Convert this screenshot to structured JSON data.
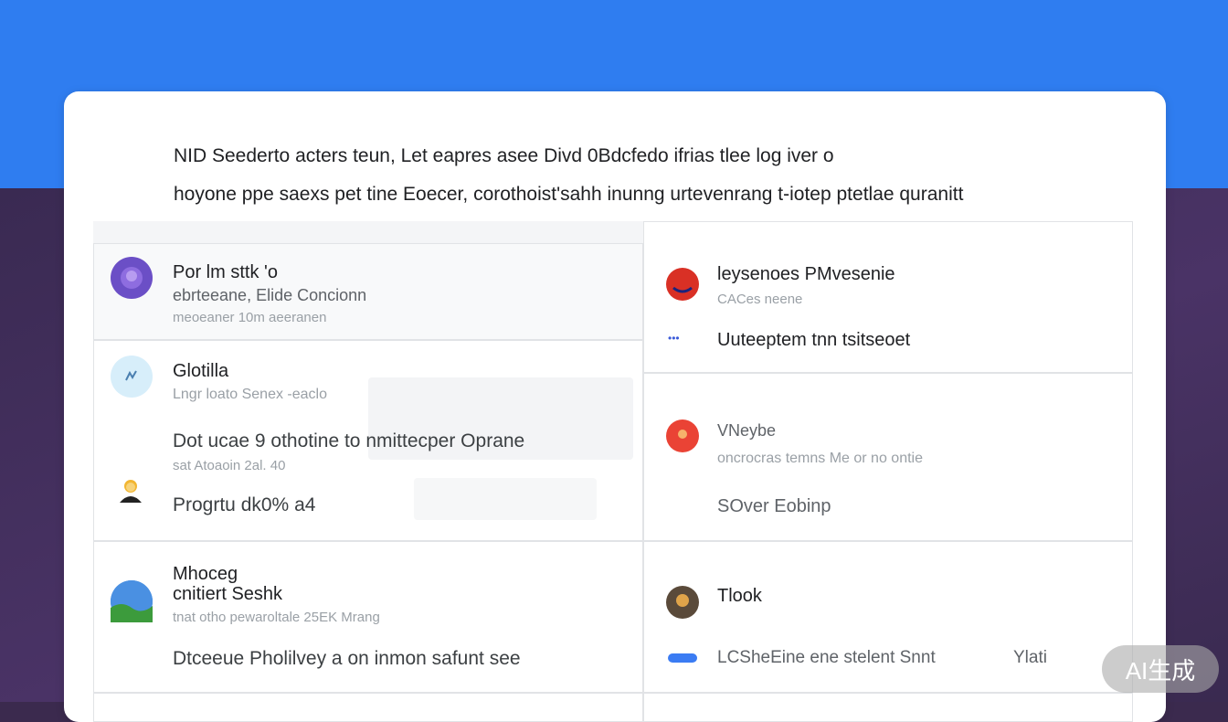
{
  "header": {
    "line1": "NID Seederto acters teun, Let eapres asee Divd 0Bdcfedo ifrias tlee log iver o",
    "line2": "hoyone ppe saexs pet tine Eoecer, corothoist'sahh inunng urtevenrang t-iotep ptetlae quranitt"
  },
  "cards": [
    {
      "id": "a",
      "title": "Por lm sttk 'o",
      "subtitle": "ebrteeane, Elide Concionn",
      "meta": "meoeaner 10m aeeranen",
      "avatar_icon": "profile-icon",
      "avatar_color": "#6b4fc6"
    },
    {
      "id": "b",
      "title": "leysenoes PMvesenie",
      "subtitle": "CACes neene",
      "body": "Uuteeptem tnn tsitseoet",
      "avatar_icon": "profile-icon",
      "avatar_color": "#d93025",
      "small_icon": "link-icon"
    },
    {
      "id": "c",
      "title": "Glotilla",
      "subtitle": "Lngr loato Senex -eaclo",
      "body": "Dot ucae 9 othotine to nmittecper Oprane",
      "meta": "sat Atoaoin 2al. 40",
      "footer": "Progrtu dk0% a4",
      "avatar_icon": "chat-icon",
      "avatar_color": "#d7eefa",
      "small_avatar_icon": "user-icon"
    },
    {
      "id": "d",
      "title": "VNeybe",
      "subtitle": "oncrocras temns Me or no ontie",
      "body": "SOver Eobinp",
      "avatar_icon": "profile-icon",
      "avatar_color": "#ea4335"
    },
    {
      "id": "e",
      "title": "Mhoceg",
      "title2": "cnitiert Seshk",
      "subtitle": "tnat otho pewaroltale 25EK Mrang",
      "body": "Dtceeue Pholilvey a on inmon safunt see",
      "avatar_icon": "globe-icon",
      "avatar_color": "#3d8be0"
    },
    {
      "id": "f",
      "title": "Tlook",
      "body": "LCSheEine ene stelent Snnt",
      "extra": "Ylati",
      "avatar_icon": "profile-icon",
      "avatar_color": "#5a4a3a"
    }
  ],
  "watermark": "AI生成"
}
